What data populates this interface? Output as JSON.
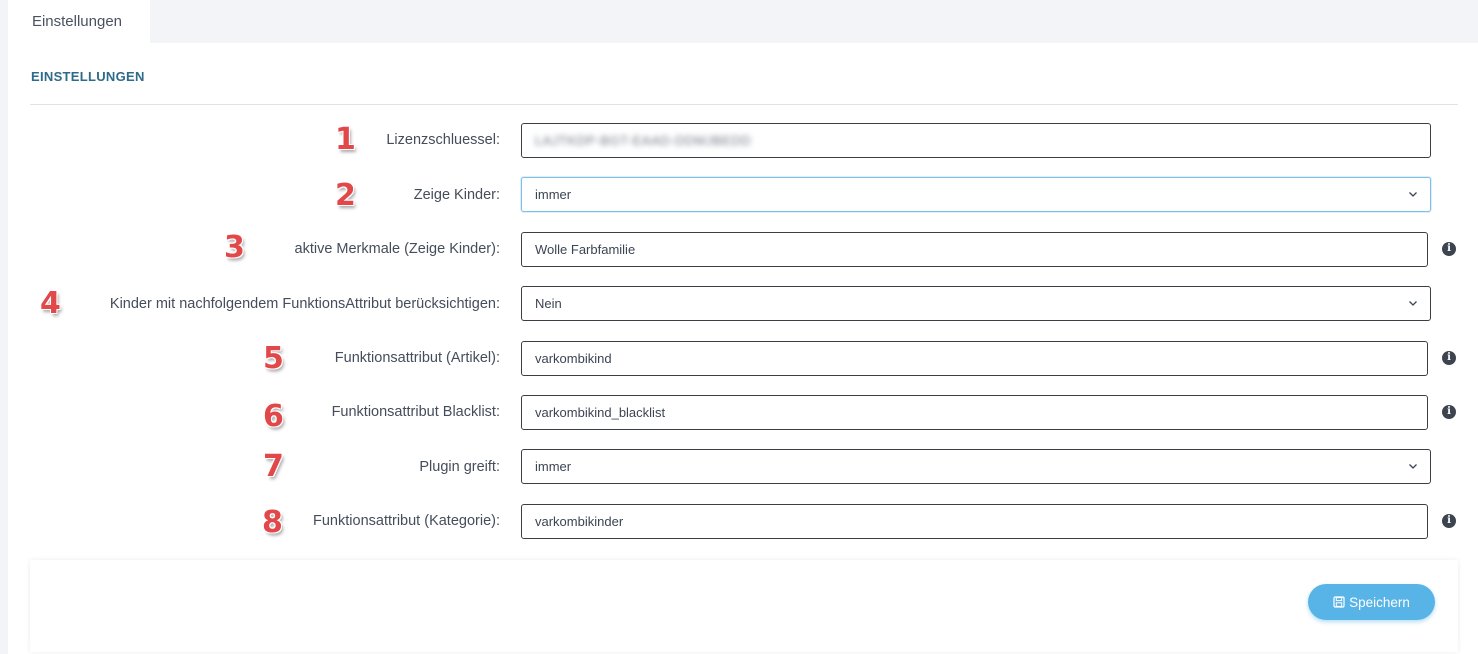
{
  "tabs": [
    {
      "label": "Einstellungen",
      "active": true
    }
  ],
  "section": {
    "title": "EINSTELLUNGEN"
  },
  "settings": [
    {
      "marker": "1",
      "label": "Lizenzschluessel:",
      "type": "text",
      "value": "LAJTKDP-BGT-EAAD-DDMJBEDD",
      "obscured": true,
      "info": false
    },
    {
      "marker": "2",
      "label": "Zeige Kinder:",
      "type": "select",
      "value": "immer",
      "focused": true,
      "info": false
    },
    {
      "marker": "3",
      "label": "aktive Merkmale (Zeige Kinder):",
      "type": "text",
      "value": "Wolle Farbfamilie",
      "info": true
    },
    {
      "marker": "4",
      "label": "Kinder mit nachfolgendem FunktionsAttribut berücksichtigen:",
      "type": "select",
      "value": "Nein",
      "info": false
    },
    {
      "marker": "5",
      "label": "Funktionsattribut (Artikel):",
      "type": "text",
      "value": "varkombikind",
      "info": true
    },
    {
      "marker": "6",
      "label": "Funktionsattribut Blacklist:",
      "type": "text",
      "value": "varkombikind_blacklist",
      "info": true
    },
    {
      "marker": "7",
      "label": "Plugin greift:",
      "type": "select",
      "value": "immer",
      "info": false
    },
    {
      "marker": "8",
      "label": "Funktionsattribut (Kategorie):",
      "type": "text",
      "value": "varkombikinder",
      "info": true
    }
  ],
  "icons": {
    "info": "info-icon",
    "select": "chevron-down-icon",
    "save": "save-icon"
  },
  "footer": {
    "save_label": "Speichern"
  },
  "colors": {
    "accent": "#58b3e6",
    "section_title": "#2e6b8a",
    "marker": "#e2474a",
    "focus": "#7cc0e6"
  }
}
